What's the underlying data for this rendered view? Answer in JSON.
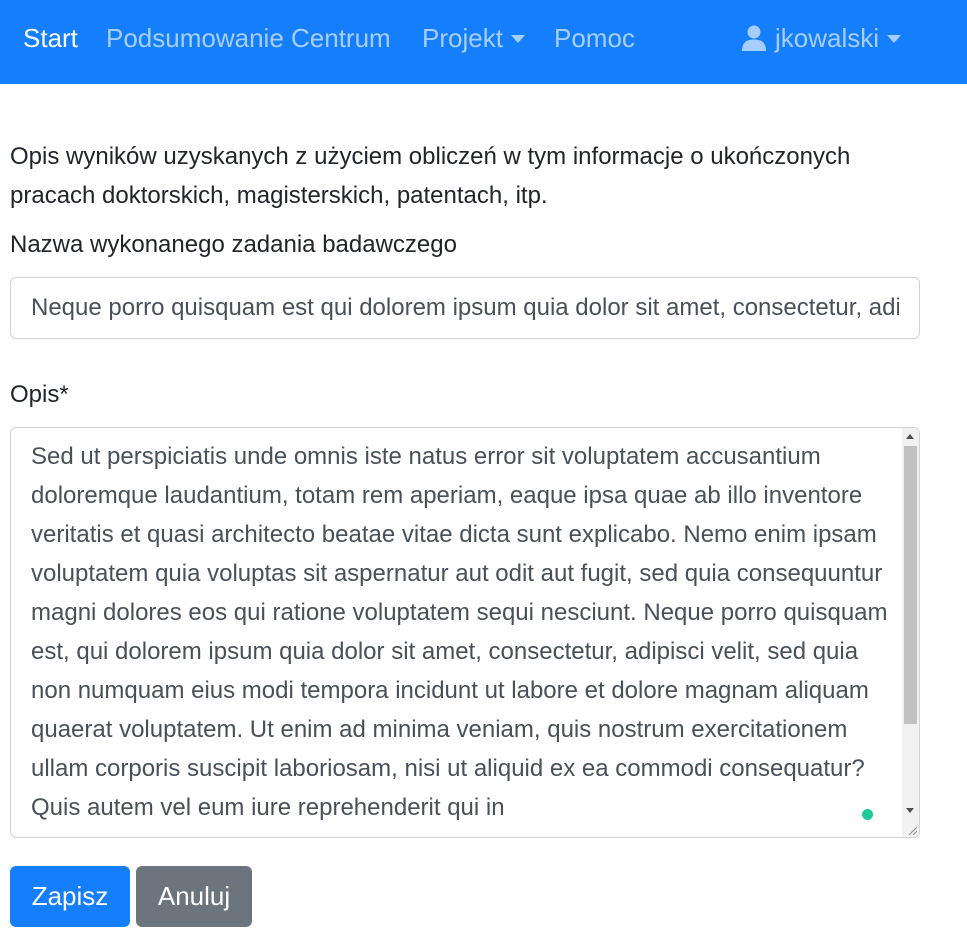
{
  "navbar": {
    "start": "Start",
    "summary": "Podsumowanie Centrum",
    "project": "Projekt",
    "help": "Pomoc",
    "user": "jkowalski",
    "bg_color": "#147efb"
  },
  "form": {
    "intro": "Opis wyników uzyskanych z użyciem obliczeń w tym informacje o ukończonych pracach doktorskich, magisterskich, patentach, itp.",
    "task_label": "Nazwa wykonanego zadania badawczego",
    "task_value": "Neque porro quisquam est qui dolorem ipsum quia dolor sit amet, consectetur, adipisci velit",
    "description_label": "Opis*",
    "description_value": "Sed ut perspiciatis unde omnis iste natus error sit voluptatem accusantium doloremque laudantium, totam rem aperiam, eaque ipsa quae ab illo inventore veritatis et quasi architecto beatae vitae dicta sunt explicabo. Nemo enim ipsam voluptatem quia voluptas sit aspernatur aut odit aut fugit, sed quia consequuntur magni dolores eos qui ratione voluptatem sequi nesciunt. Neque porro quisquam est, qui dolorem ipsum quia dolor sit amet, consectetur, adipisci velit, sed quia non numquam eius modi tempora incidunt ut labore et dolore magnam aliquam quaerat voluptatem. Ut enim ad minima veniam, quis nostrum exercitationem ullam corporis suscipit laboriosam, nisi ut aliquid ex ea commodi consequatur? Quis autem vel eum iure reprehenderit qui in"
  },
  "buttons": {
    "save": "Zapisz",
    "cancel": "Anuluj"
  },
  "colors": {
    "primary": "#147efb",
    "secondary": "#6c757d",
    "status_dot": "#20c997"
  },
  "icons": {
    "user": "user-icon",
    "caret": "chevron-down-icon"
  }
}
